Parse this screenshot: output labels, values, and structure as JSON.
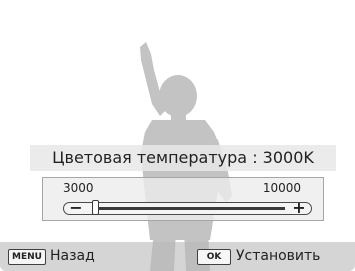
{
  "setting": {
    "title": "Цветовая температура : 3000K"
  },
  "slider": {
    "min_label": "3000",
    "max_label": "10000",
    "minus_symbol": "−",
    "plus_symbol": "+",
    "current_value": 3000,
    "min_value": 3000,
    "max_value": 10000
  },
  "bottom_bar": {
    "menu_key": "MENU",
    "back_label": "Назад",
    "ok_key": "OK",
    "set_label": "Установить"
  },
  "colors": {
    "silhouette": "#c3c3c3",
    "bar_background": "#b9b9b9"
  },
  "icons": {
    "preview": "child-silhouette-pointing-up"
  }
}
